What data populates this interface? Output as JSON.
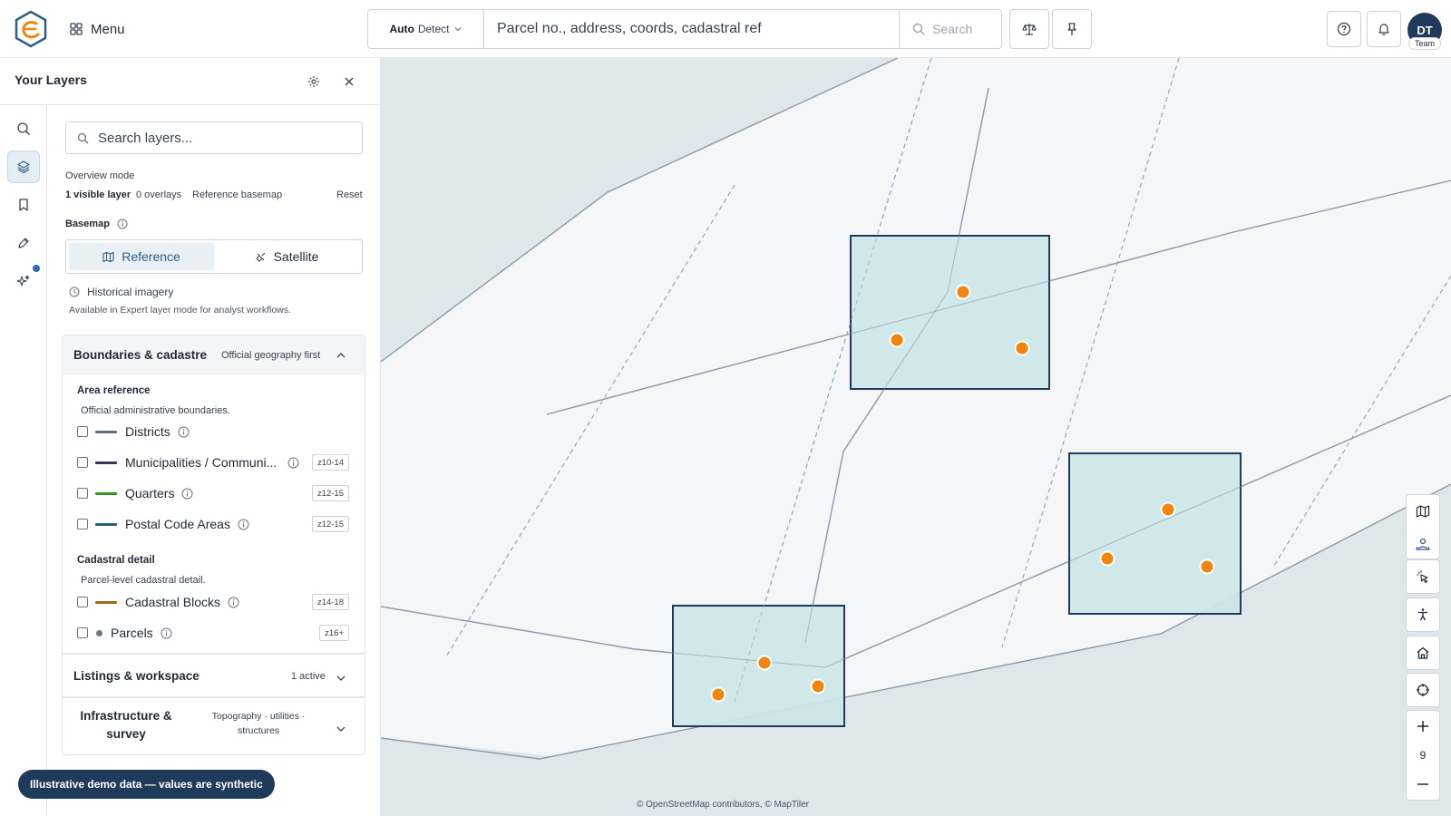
{
  "header": {
    "menu_label": "Menu",
    "detect_prefix": "Auto",
    "detect_label": "Detect",
    "search_placeholder": "Parcel no., address, coords, cadastral ref",
    "search_button": "Search",
    "avatar_initials": "DT",
    "avatar_tag": "Team"
  },
  "panel": {
    "title": "Your Layers",
    "search_placeholder": "Search layers...",
    "overview_mode": "Overview mode",
    "stats": {
      "visible": "1 visible layer",
      "overlays": "0 overlays",
      "basemap": "Reference basemap",
      "reset": "Reset"
    },
    "basemap_label": "Basemap",
    "basemap_options": [
      "Reference",
      "Satellite"
    ],
    "basemap_selected": "Reference",
    "historical_title": "Historical imagery",
    "historical_note": "Available in Expert layer mode for analyst workflows."
  },
  "groups": {
    "boundaries": {
      "title": "Boundaries & cadastre",
      "subtitle": "Official geography first",
      "expanded": true,
      "area_title": "Area reference",
      "area_note": "Official administrative boundaries.",
      "area_layers": [
        {
          "name": "Districts",
          "color": "#5b6f7f",
          "zoom": "",
          "checked": false
        },
        {
          "name": "Municipalities / Communi...",
          "color": "#34385a",
          "zoom": "z10-14",
          "checked": false
        },
        {
          "name": "Quarters",
          "color": "#2f9a1e",
          "zoom": "z12-15",
          "checked": false
        },
        {
          "name": "Postal Code Areas",
          "color": "#2b5f78",
          "zoom": "z12-15",
          "checked": false
        }
      ],
      "cad_title": "Cadastral detail",
      "cad_note": "Parcel-level cadastral detail.",
      "cad_layers": [
        {
          "name": "Cadastral Blocks",
          "color": "#a0671e",
          "zoom": "z14-18",
          "checked": false
        },
        {
          "name": "Parcels",
          "color": "#6b7785",
          "zoom": "z16+",
          "checked": false
        }
      ]
    },
    "listings": {
      "title": "Listings & workspace",
      "badge": "1 active"
    },
    "infra": {
      "title": "Infrastructure & survey",
      "subtitle": "Topography · utilities · structures"
    }
  },
  "toast": "Illustrative demo data — values are synthetic",
  "map": {
    "attribution": "© OpenStreetMap contributors, © MapTiler",
    "zoom_level": "9",
    "colors": {
      "parcel_fill": "#cde6e8",
      "parcel_stroke": "#1f3a5a",
      "marker": "#f0850f",
      "road": "#8a9aaa",
      "water": "#dde7ec"
    }
  }
}
